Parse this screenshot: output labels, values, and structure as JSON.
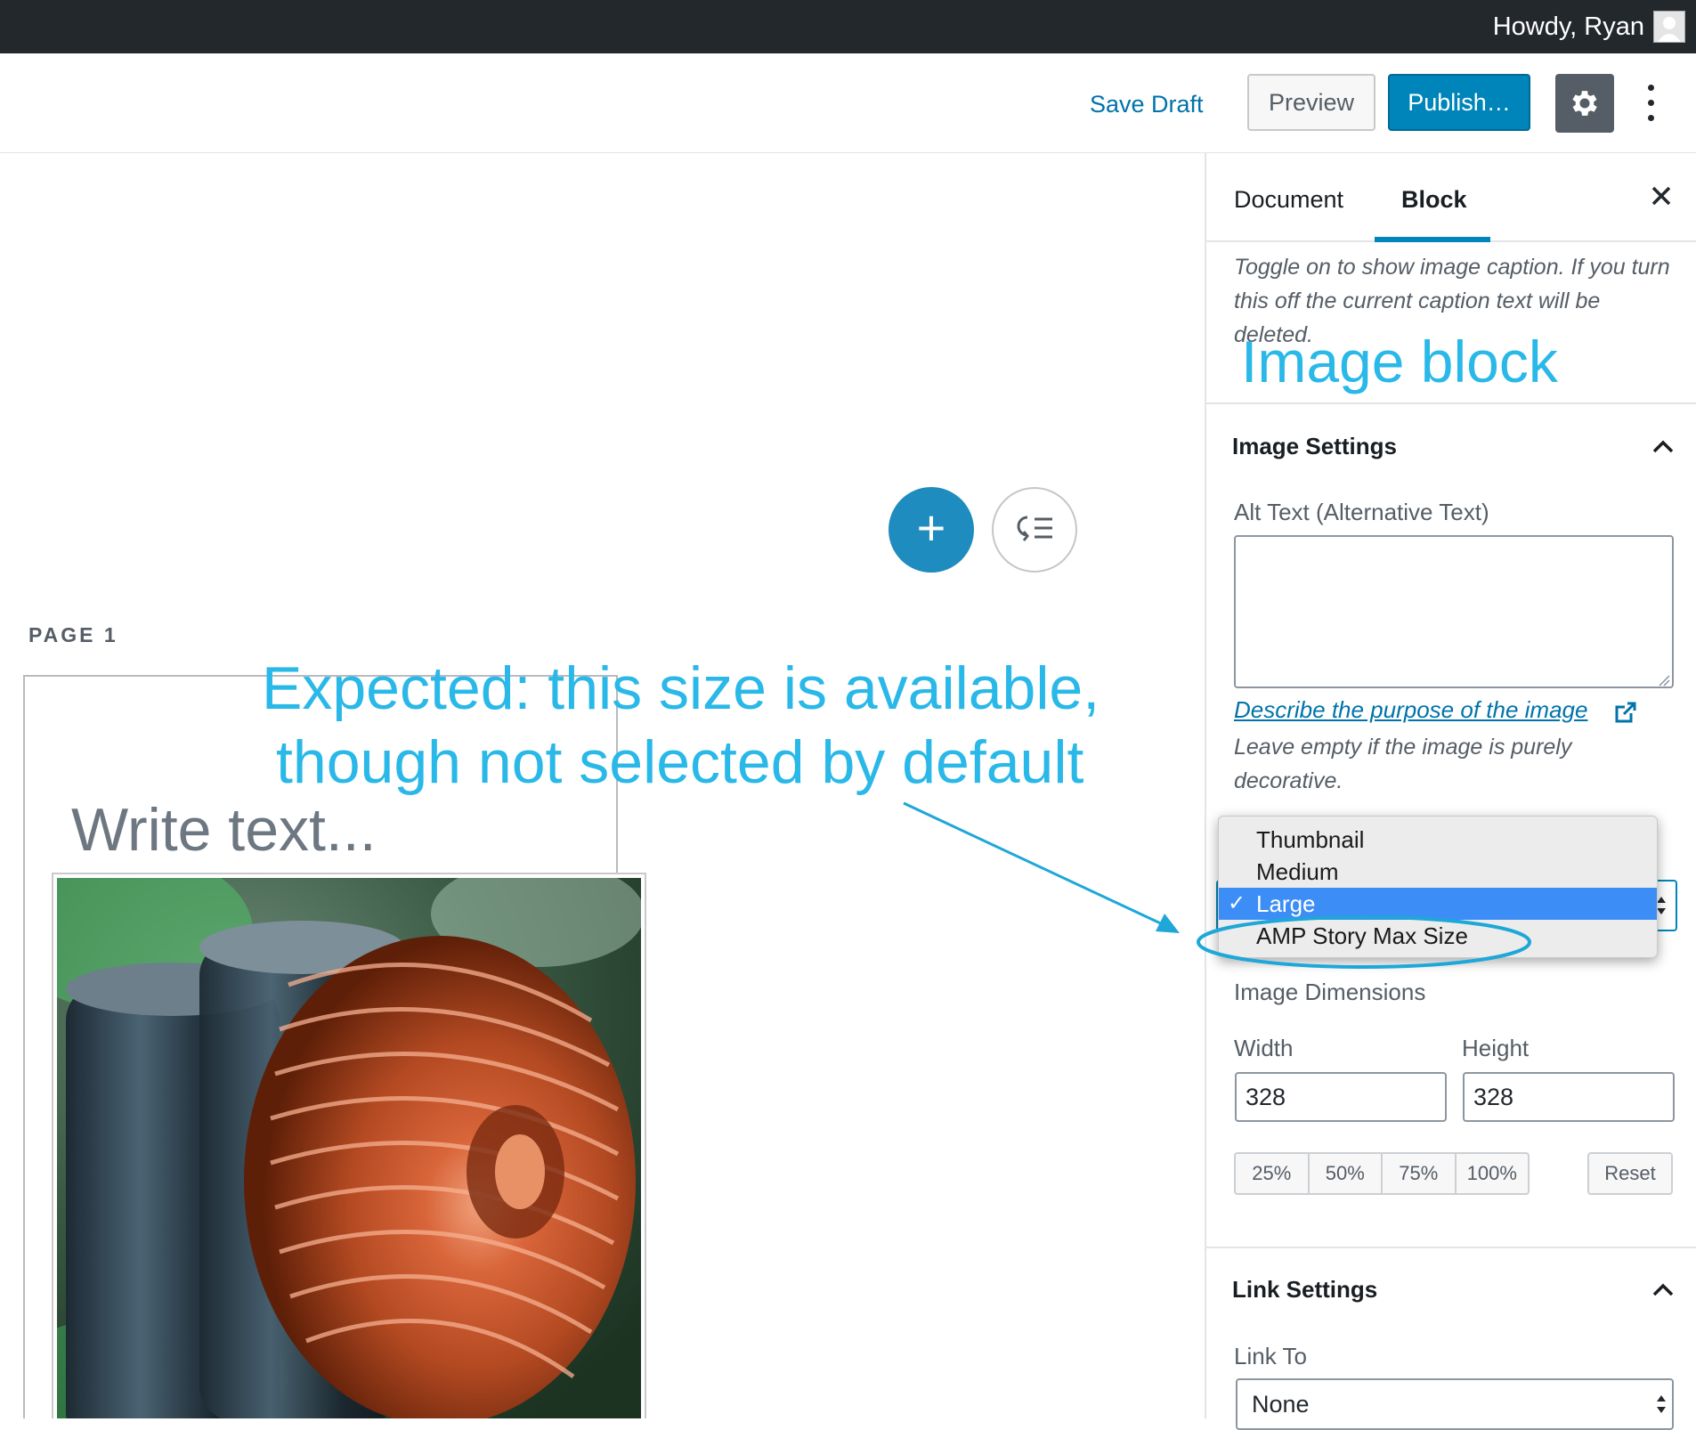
{
  "admin_bar": {
    "greeting": "Howdy, Ryan"
  },
  "header": {
    "save_draft": "Save Draft",
    "preview": "Preview",
    "publish": "Publish…"
  },
  "sidebar": {
    "tabs": [
      "Document",
      "Block"
    ],
    "active_tab": "Block",
    "caption_help": "Toggle on to show image caption. If you turn this off the current caption text will be deleted.",
    "image_settings": {
      "title": "Image Settings",
      "alt_label": "Alt Text (Alternative Text)",
      "alt_value": "",
      "describe_link": "Describe the purpose of the image",
      "alt_help": "Leave empty if the image is purely decorative.",
      "size_options": [
        "Thumbnail",
        "Medium",
        "Large",
        "AMP Story Max Size"
      ],
      "size_selected": "Large",
      "dimensions_label": "Image Dimensions",
      "width_label": "Width",
      "height_label": "Height",
      "width_value": "328",
      "height_value": "328",
      "percent_buttons": [
        "25%",
        "50%",
        "75%",
        "100%"
      ],
      "reset": "Reset"
    },
    "link_settings": {
      "title": "Link Settings",
      "link_to_label": "Link To",
      "link_to_value": "None"
    }
  },
  "canvas": {
    "page_label": "PAGE 1",
    "placeholder": "Write text..."
  },
  "annotations": {
    "image_block": "Image block",
    "expected_line1": "Expected: this size is available,",
    "expected_line2": "though not selected by default",
    "color": "#29b8e8"
  },
  "colors": {
    "accent": "#0085ba",
    "admin_bar": "#23282d",
    "selected_option": "#3c8ef6"
  }
}
